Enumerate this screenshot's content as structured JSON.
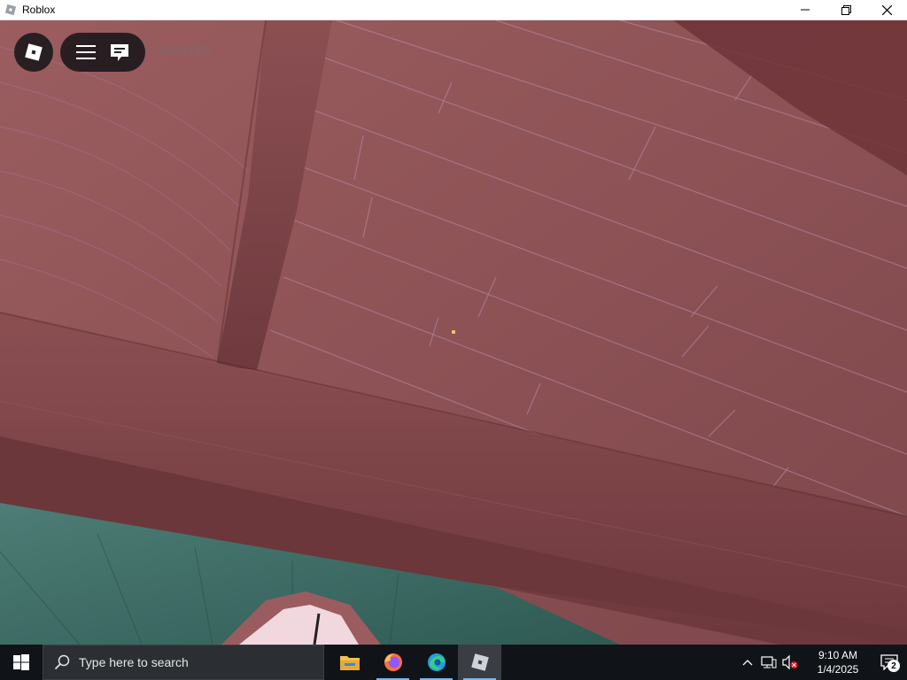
{
  "window": {
    "title": "Roblox",
    "minimize_label": "—",
    "maximize_label": "❐",
    "close_label": "✕"
  },
  "hud": {
    "player_id_text": "3403755",
    "icons": [
      "roblox-logo-icon",
      "menu-icon",
      "chat-icon"
    ]
  },
  "taskbar": {
    "search_placeholder": "Type here to search",
    "apps": [
      "file-explorer",
      "firefox",
      "edge",
      "roblox"
    ],
    "clock_time": "9:10 AM",
    "clock_date": "1/4/2025",
    "notification_count": "2"
  },
  "colors": {
    "taskbar_bg": "#101418",
    "wood_light": "#9a5a5c",
    "wood_dark": "#6a383c",
    "floor": "#3f6e66",
    "accent_running": "#76b9ed"
  }
}
